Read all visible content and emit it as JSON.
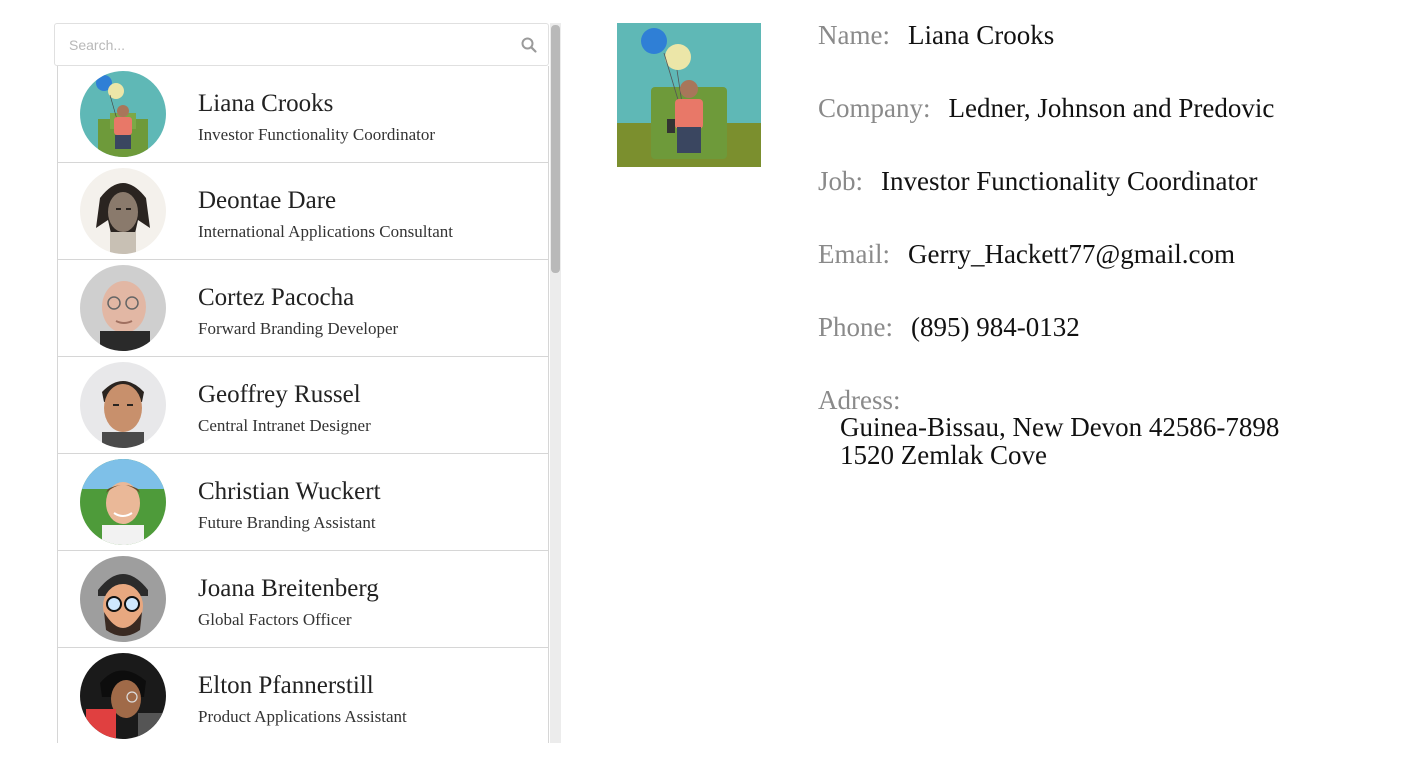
{
  "search": {
    "placeholder": "Search..."
  },
  "contacts": [
    {
      "name": "Liana Crooks",
      "title": "Investor Functionality Coordinator",
      "avatar": "liana"
    },
    {
      "name": "Deontae Dare",
      "title": "International Applications Consultant",
      "avatar": "deontae"
    },
    {
      "name": "Cortez Pacocha",
      "title": "Forward Branding Developer",
      "avatar": "cortez"
    },
    {
      "name": "Geoffrey Russel",
      "title": "Central Intranet Designer",
      "avatar": "geoffrey"
    },
    {
      "name": "Christian Wuckert",
      "title": "Future Branding Assistant",
      "avatar": "christian"
    },
    {
      "name": "Joana Breitenberg",
      "title": "Global Factors Officer",
      "avatar": "joana"
    },
    {
      "name": "Elton Pfannerstill",
      "title": "Product Applications Assistant",
      "avatar": "elton"
    }
  ],
  "detail": {
    "name_label": "Name:",
    "name": "Liana Crooks",
    "company_label": "Company:",
    "company": "Ledner, Johnson and Predovic",
    "job_label": "Job:",
    "job": "Investor Functionality Coordinator",
    "email_label": "Email:",
    "email": "Gerry_Hackett77@gmail.com",
    "phone_label": "Phone:",
    "phone": "(895) 984-0132",
    "address_label": "Adress:",
    "address_line1": "Guinea-Bissau, New Devon 42586-7898",
    "address_line2": "1520 Zemlak Cove"
  },
  "colors": {
    "label": "#8a8a8a",
    "value": "#111111",
    "divider": "#d6d6d6",
    "scrollbar_thumb": "#b9b9b9"
  }
}
